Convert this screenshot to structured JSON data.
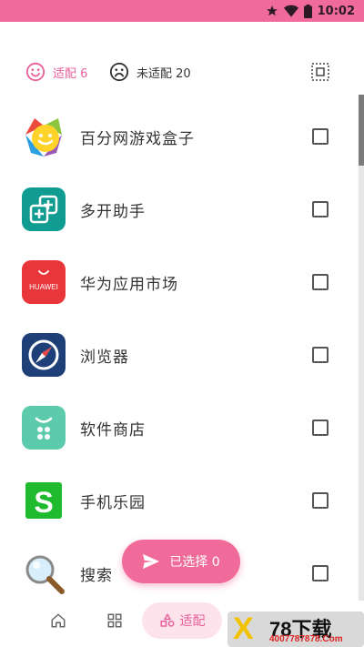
{
  "status_bar": {
    "time": "10:02",
    "icons": [
      "star-icon",
      "wifi-icon",
      "battery-icon"
    ]
  },
  "filters": {
    "adapted_label": "适配 6",
    "unadapted_label": "未适配 20"
  },
  "apps": [
    {
      "name": "百分网游戏盒子",
      "icon": "baifen-game-box-icon"
    },
    {
      "name": "多开助手",
      "icon": "multi-open-icon"
    },
    {
      "name": "华为应用市场",
      "icon": "huawei-appgallery-icon",
      "icon_text": "HUAWEI"
    },
    {
      "name": "浏览器",
      "icon": "browser-compass-icon"
    },
    {
      "name": "软件商店",
      "icon": "software-store-icon"
    },
    {
      "name": "手机乐园",
      "icon": "phone-paradise-icon",
      "icon_text": "S"
    },
    {
      "name": "搜索",
      "icon": "search-magnifier-icon"
    }
  ],
  "fab": {
    "label": "已选择 0"
  },
  "bottom_nav": {
    "active_label": "适配",
    "items": [
      "home-icon",
      "grid-icon",
      "adapt-icon"
    ]
  },
  "watermark": {
    "mark": "X",
    "brand": "78下载",
    "url": "4007787878.Com"
  },
  "colors": {
    "accent": "#f06a9a",
    "accent_text": "#e8609a",
    "pill_bg": "#fde3ec"
  }
}
